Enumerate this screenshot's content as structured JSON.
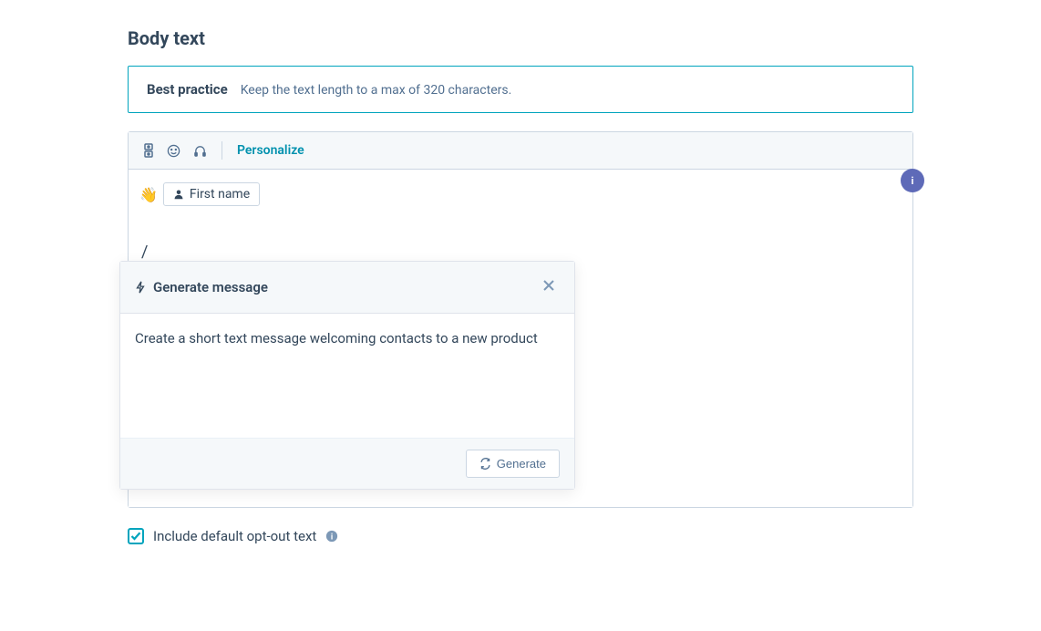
{
  "heading": "Body text",
  "bestPractice": {
    "label": "Best practice",
    "text": "Keep the text length to a max of 320 characters."
  },
  "toolbar": {
    "personalize": "Personalize"
  },
  "editor": {
    "wave_emoji": "👋",
    "token_label": "First name",
    "slash": "/"
  },
  "popup": {
    "title": "Generate message",
    "prompt": "Create a short text message welcoming contacts to a new product",
    "generate_button": "Generate"
  },
  "optout": {
    "label": "Include default opt-out text",
    "checked": true
  },
  "info_char": "i"
}
